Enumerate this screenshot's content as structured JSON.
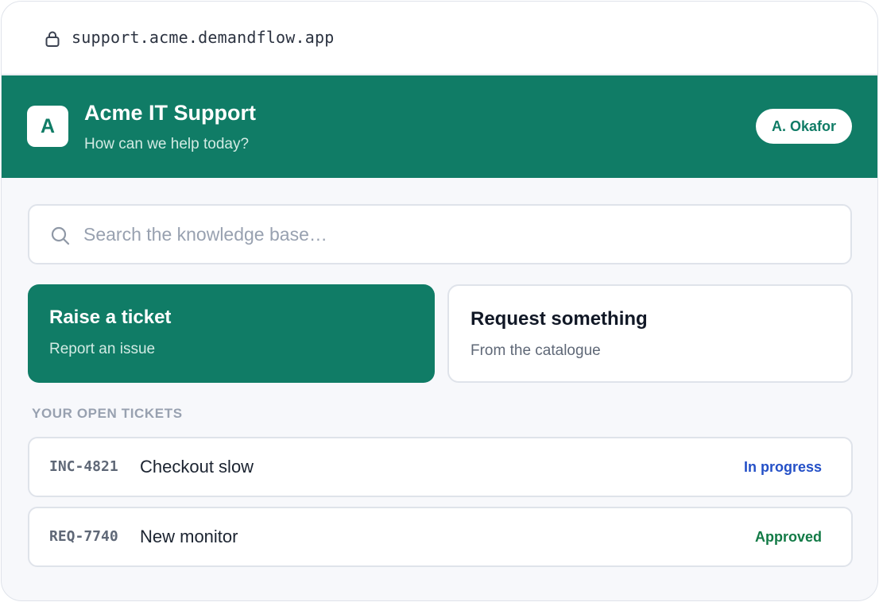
{
  "browser": {
    "url": "support.acme.demandflow.app",
    "lock_icon": "lock-icon"
  },
  "header": {
    "logo_letter": "A",
    "title": "Acme IT Support",
    "subtitle": "How can we help today?",
    "user": "A. Okafor"
  },
  "search": {
    "placeholder": "Search the knowledge base…",
    "value": "",
    "icon": "search-icon"
  },
  "actions": [
    {
      "title": "Raise a ticket",
      "subtitle": "Report an issue"
    },
    {
      "title": "Request something",
      "subtitle": "From the catalogue"
    }
  ],
  "tickets_section": {
    "label": "YOUR OPEN TICKETS",
    "items": [
      {
        "id": "INC-4821",
        "title": "Checkout slow",
        "status": "In progress",
        "status_color": "#2450c7"
      },
      {
        "id": "REQ-7740",
        "title": "New monitor",
        "status": "Approved",
        "status_color": "#127a46"
      }
    ]
  },
  "colors": {
    "brand": "#107c66",
    "background": "#f7f8fb",
    "border": "#dfe3ea"
  }
}
